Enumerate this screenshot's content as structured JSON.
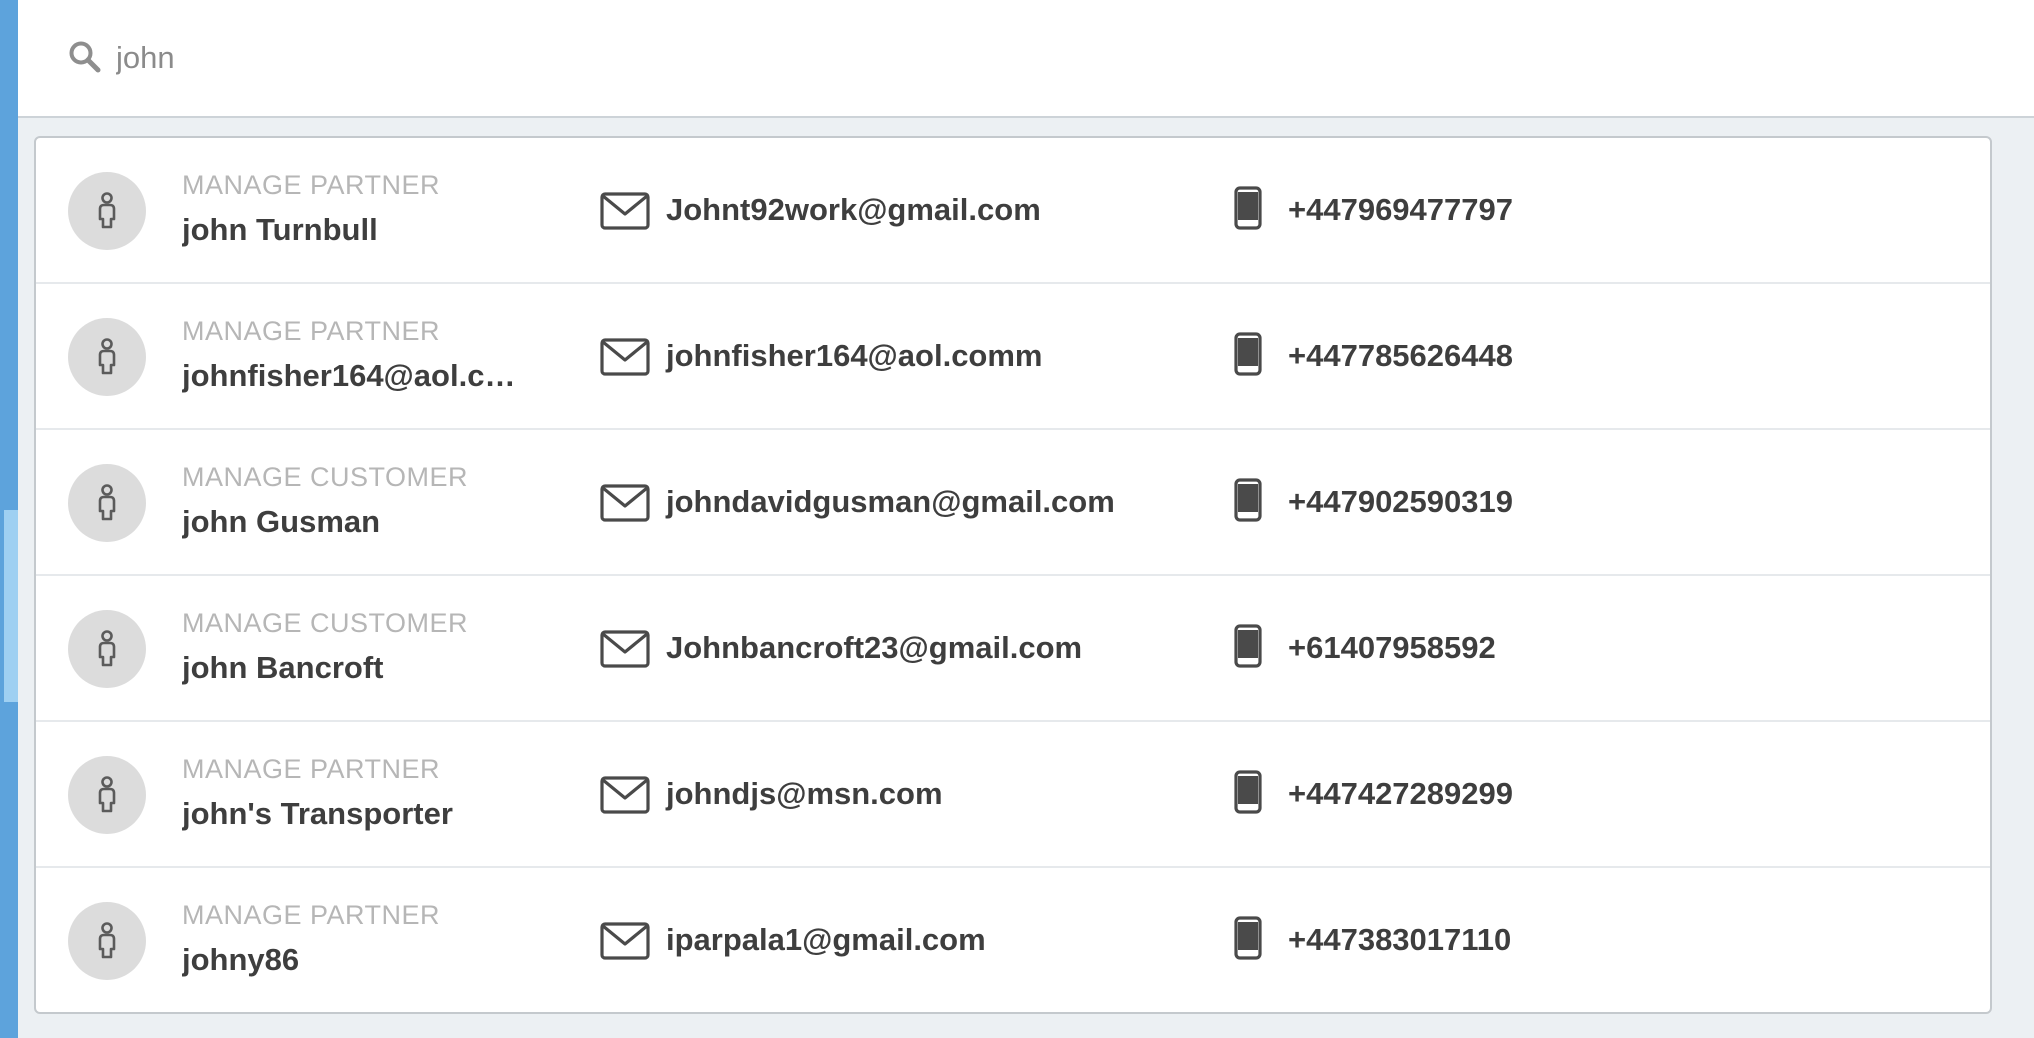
{
  "search": {
    "value": "john",
    "icon": "search-icon"
  },
  "colors": {
    "rail": "#5da3dc",
    "rail_highlight": "#9fd0f2",
    "text_primary": "#3e3e3e",
    "text_muted": "#b6b6b6",
    "avatar_bg": "#dcdcdc"
  },
  "results": [
    {
      "role": "MANAGE PARTNER",
      "name": "john Turnbull",
      "email": "Johnt92work@gmail.com",
      "phone": "+447969477797"
    },
    {
      "role": "MANAGE PARTNER",
      "name": "johnfisher164@aol.co…",
      "email": "johnfisher164@aol.comm",
      "phone": "+447785626448"
    },
    {
      "role": "MANAGE CUSTOMER",
      "name": "john Gusman",
      "email": "johndavidgusman@gmail.com",
      "phone": "+447902590319"
    },
    {
      "role": "MANAGE CUSTOMER",
      "name": "john Bancroft",
      "email": "Johnbancroft23@gmail.com",
      "phone": "+61407958592"
    },
    {
      "role": "MANAGE PARTNER",
      "name": "john's Transporter",
      "email": "johndjs@msn.com",
      "phone": "+447427289299"
    },
    {
      "role": "MANAGE PARTNER",
      "name": "johny86",
      "email": "iparpala1@gmail.com",
      "phone": "+447383017110"
    }
  ]
}
